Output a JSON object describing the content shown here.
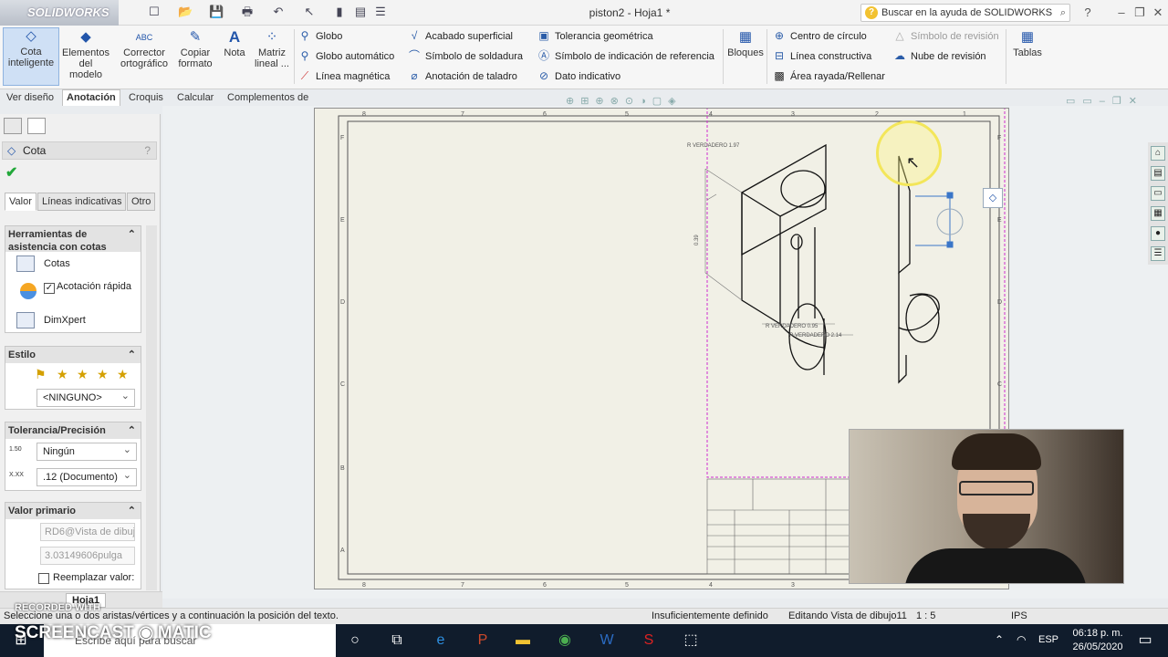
{
  "app": {
    "logo": "SOLIDWORKS",
    "title": "piston2 - Hoja1 *",
    "help_search_placeholder": "Buscar en la ayuda de SOLIDWORKS"
  },
  "ribbon": {
    "big_buttons": [
      {
        "label": "Cota inteligente",
        "icon": "smart-dimension-icon"
      },
      {
        "label": "Elementos del modelo",
        "icon": "model-items-icon"
      },
      {
        "label": "Corrector ortográfico",
        "icon": "spell-check-icon"
      },
      {
        "label": "Copiar formato",
        "icon": "format-painter-icon"
      },
      {
        "label": "Nota",
        "icon": "note-icon"
      },
      {
        "label": "Matriz lineal ...",
        "icon": "linear-pattern-icon"
      }
    ],
    "col1": [
      "Globo",
      "Globo automático",
      "Línea magnética"
    ],
    "col2": [
      "Acabado superficial",
      "Símbolo de soldadura",
      "Anotación de taladro"
    ],
    "col3": [
      "Tolerancia geométrica",
      "Símbolo de indicación de referencia",
      "Dato indicativo"
    ],
    "blocks_label": "Bloques",
    "col4": [
      "Centro de círculo",
      "Línea constructiva",
      "Área rayada/Rellenar"
    ],
    "col5": [
      "Símbolo de revisión",
      "Nube de revisión"
    ],
    "tables_label": "Tablas"
  },
  "tabs": [
    "Ver diseño",
    "Anotación",
    "Croquis",
    "Calcular",
    "Complementos de SOLIDWORKS"
  ],
  "active_tab": "Anotación",
  "property_manager": {
    "title": "Cota",
    "tabs": [
      "Valor",
      "Líneas indicativas",
      "Otro"
    ],
    "assist_group": {
      "title": "Herramientas de asistencia con cotas",
      "items": [
        "Cotas",
        "Acotación rápida",
        "DimXpert"
      ],
      "quick_dim_checked": true
    },
    "style_group": {
      "title": "Estilo",
      "selected": "<NINGUNO>"
    },
    "tolerance_group": {
      "title": "Tolerancia/Precisión",
      "tolerance": "Ningún",
      "precision": ".12 (Documento)",
      "tol_icon_text": "1.50",
      "prec_icon_text": "X.XX"
    },
    "primary_group": {
      "title": "Valor primario",
      "name": "RD6@Vista de dibujo",
      "value": "3.03149606pulga",
      "override_label": "Reemplazar valor:"
    }
  },
  "sheet_tab": "Hoja1",
  "drawing": {
    "annotations": [
      "R VERDADERO 1.97",
      "R VERDADERO 0.95",
      "R VERDADERO 2.14",
      "0.39"
    ],
    "border_numbers": [
      "8",
      "7",
      "6",
      "5",
      "4",
      "3",
      "2",
      "1"
    ],
    "border_letters": [
      "F",
      "E",
      "D",
      "C",
      "B",
      "A"
    ]
  },
  "status_bar": {
    "message": "Seleccione una o dos aristas/vértices y a continuación la posición del texto.",
    "definition": "Insuficientemente definido",
    "editing": "Editando Vista de dibujo11",
    "scale": "1 : 5",
    "units": "IPS"
  },
  "watermark": {
    "top": "RECORDED WITH",
    "brand": "SCREENCAST",
    "brand2": "MATIC"
  },
  "taskbar": {
    "search": "Escribe aquí para buscar",
    "lang": "ESP",
    "time": "06:18 p. m.",
    "date": "26/05/2020"
  }
}
